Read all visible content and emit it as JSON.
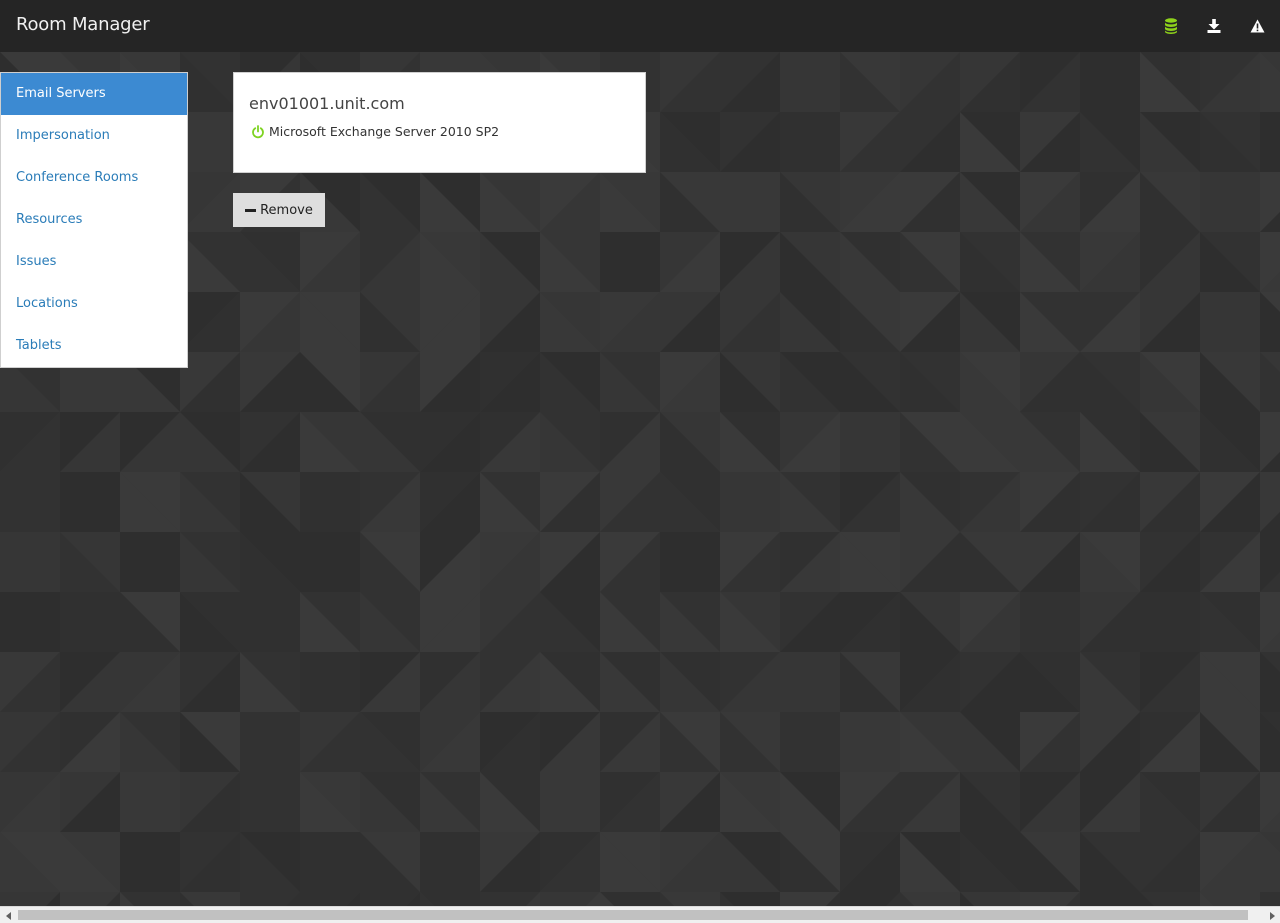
{
  "app": {
    "title": "Room Manager"
  },
  "topbar_icons": [
    {
      "name": "database-icon",
      "color": "#8ed21b"
    },
    {
      "name": "download-icon",
      "color": "#ffffff"
    },
    {
      "name": "warning-icon",
      "color": "#ffffff"
    }
  ],
  "sidebar": {
    "items": [
      {
        "label": "Email Servers",
        "active": true
      },
      {
        "label": "Impersonation"
      },
      {
        "label": "Conference Rooms"
      },
      {
        "label": "Resources"
      },
      {
        "label": "Issues"
      },
      {
        "label": "Locations"
      },
      {
        "label": "Tablets"
      }
    ]
  },
  "server": {
    "hostname": "env01001.unit.com",
    "version": "Microsoft Exchange Server 2010 SP2",
    "status_icon": "power-icon",
    "status_color": "#7ed321"
  },
  "actions": {
    "remove_label": "Remove"
  },
  "colors": {
    "accent": "#3c8ad2",
    "link": "#2a7cb8",
    "topbar": "#252525",
    "background": "#353535"
  }
}
